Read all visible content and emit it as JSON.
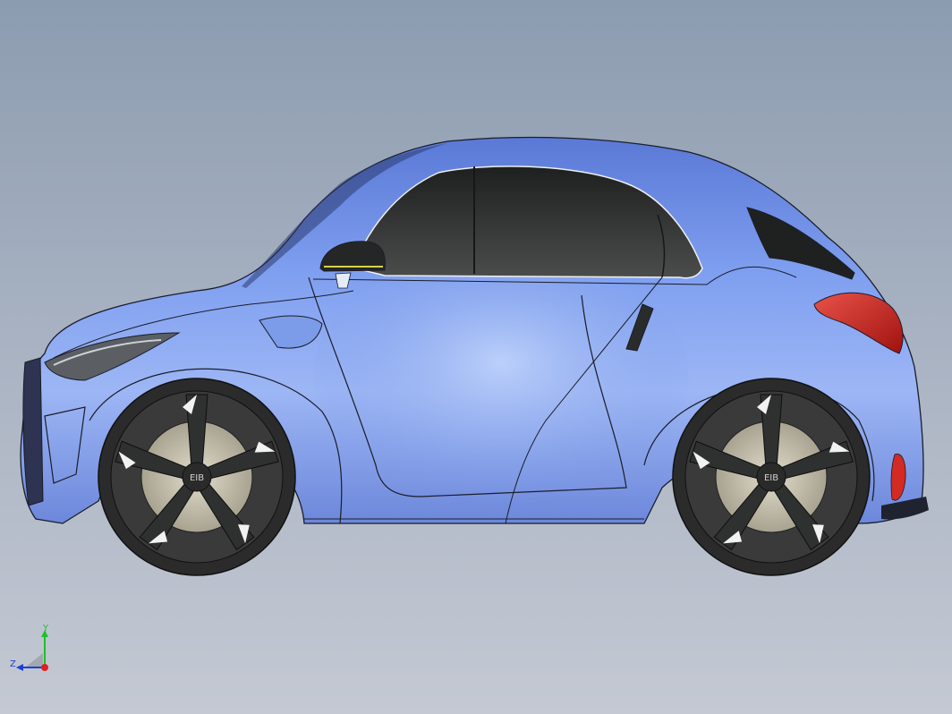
{
  "viewport": {
    "background_top": "#8c9cb0",
    "background_bottom": "#c4c9d3"
  },
  "model": {
    "body_color": "#6f8fe0",
    "glass_color": "#2a2c2c",
    "taillight_color": "#c8201e",
    "tire_color": "#2b2b2b",
    "rim_color": "#3a3a3a",
    "hub_color": "#b9b2a0",
    "wheel_logo": "EIB"
  },
  "triad": {
    "y_label": "Y",
    "z_label": "Z",
    "y_color": "#1fbf2a",
    "z_color": "#2040d0",
    "x_color": "#e02020"
  }
}
